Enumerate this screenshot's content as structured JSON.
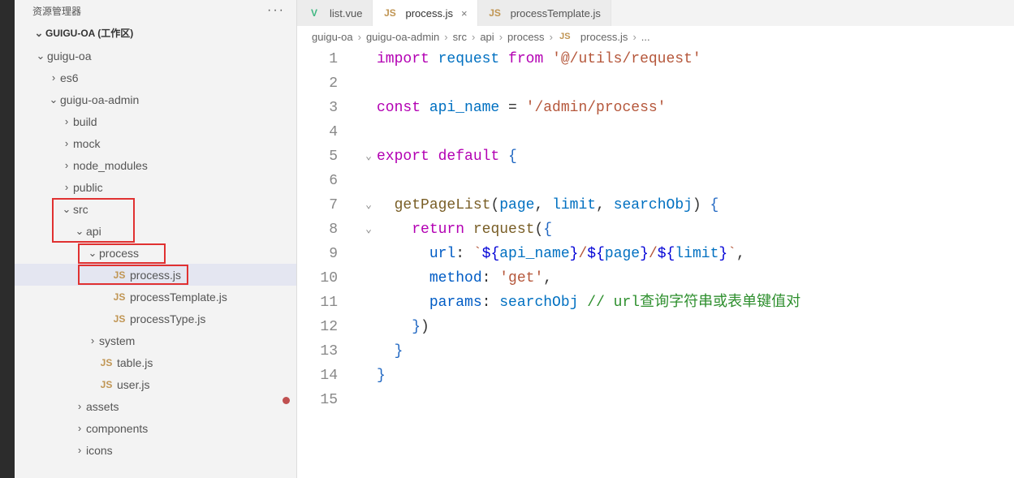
{
  "sidebar": {
    "header": "资源管理器",
    "workspace": "GUIGU-OA (工作区)",
    "tree": [
      {
        "indent": 1,
        "chevron": "down",
        "label": "guigu-oa"
      },
      {
        "indent": 2,
        "chevron": "right",
        "label": "es6"
      },
      {
        "indent": 2,
        "chevron": "down",
        "label": "guigu-oa-admin"
      },
      {
        "indent": 3,
        "chevron": "right",
        "label": "build"
      },
      {
        "indent": 3,
        "chevron": "right",
        "label": "mock"
      },
      {
        "indent": 3,
        "chevron": "right",
        "label": "node_modules"
      },
      {
        "indent": 3,
        "chevron": "right",
        "label": "public"
      },
      {
        "indent": 3,
        "chevron": "down",
        "label": "src"
      },
      {
        "indent": 4,
        "chevron": "down",
        "label": "api"
      },
      {
        "indent": 5,
        "chevron": "down",
        "label": "process"
      },
      {
        "indent": 6,
        "chevron": "",
        "icon": "JS",
        "label": "process.js",
        "selected": true
      },
      {
        "indent": 6,
        "chevron": "",
        "icon": "JS",
        "label": "processTemplate.js"
      },
      {
        "indent": 6,
        "chevron": "",
        "icon": "JS",
        "label": "processType.js"
      },
      {
        "indent": 5,
        "chevron": "right",
        "label": "system"
      },
      {
        "indent": 5,
        "chevron": "",
        "icon": "JS",
        "label": "table.js"
      },
      {
        "indent": 5,
        "chevron": "",
        "icon": "JS",
        "label": "user.js"
      },
      {
        "indent": 4,
        "chevron": "right",
        "label": "assets"
      },
      {
        "indent": 4,
        "chevron": "right",
        "label": "components"
      },
      {
        "indent": 4,
        "chevron": "right",
        "label": "icons"
      }
    ]
  },
  "tabs": [
    {
      "icon": "V",
      "iconClass": "vue-icon",
      "label": "list.vue",
      "active": false
    },
    {
      "icon": "JS",
      "iconClass": "js-icon",
      "label": "process.js",
      "active": true,
      "close": true
    },
    {
      "icon": "JS",
      "iconClass": "js-icon",
      "label": "processTemplate.js",
      "active": false
    }
  ],
  "breadcrumb": [
    "guigu-oa",
    "guigu-oa-admin",
    "src",
    "api",
    "process",
    "process.js",
    "..."
  ],
  "breadcrumb_file_icon": "JS",
  "code": {
    "line_count": 15,
    "folds": {
      "5": "v",
      "7": "v",
      "8": "v"
    },
    "dirty_line": 15,
    "lines": {
      "1": [
        [
          "kw",
          "import "
        ],
        [
          "var",
          "request"
        ],
        [
          "kw",
          " from "
        ],
        [
          "str",
          "'@/utils/request'"
        ]
      ],
      "2": [],
      "3": [
        [
          "kw",
          "const "
        ],
        [
          "var",
          "api_name"
        ],
        [
          "",
          " = "
        ],
        [
          "str",
          "'/admin/process'"
        ]
      ],
      "4": [],
      "5": [
        [
          "kw",
          "export default "
        ],
        [
          "brace",
          "{"
        ]
      ],
      "6": [],
      "7": [
        [
          "",
          "  "
        ],
        [
          "fn",
          "getPageList"
        ],
        [
          "",
          "("
        ],
        [
          "prop",
          "page"
        ],
        [
          "",
          ", "
        ],
        [
          "prop",
          "limit"
        ],
        [
          "",
          ", "
        ],
        [
          "prop",
          "searchObj"
        ],
        [
          "",
          ") "
        ],
        [
          "brace",
          "{"
        ]
      ],
      "8": [
        [
          "",
          "    "
        ],
        [
          "kw",
          "return "
        ],
        [
          "fn",
          "request"
        ],
        [
          "",
          "("
        ],
        [
          "brace",
          "{"
        ]
      ],
      "9": [
        [
          "",
          "      "
        ],
        [
          "mem",
          "url"
        ],
        [
          "",
          ": "
        ],
        [
          "str",
          "`"
        ],
        [
          "tmpl",
          "${"
        ],
        [
          "var",
          "api_name"
        ],
        [
          "tmpl",
          "}"
        ],
        [
          "str",
          "/"
        ],
        [
          "tmpl",
          "${"
        ],
        [
          "prop",
          "page"
        ],
        [
          "tmpl",
          "}"
        ],
        [
          "str",
          "/"
        ],
        [
          "tmpl",
          "${"
        ],
        [
          "prop",
          "limit"
        ],
        [
          "tmpl",
          "}"
        ],
        [
          "str",
          "`"
        ],
        [
          "",
          ","
        ]
      ],
      "10": [
        [
          "",
          "      "
        ],
        [
          "mem",
          "method"
        ],
        [
          "",
          ": "
        ],
        [
          "str",
          "'get'"
        ],
        [
          "",
          ","
        ]
      ],
      "11": [
        [
          "",
          "      "
        ],
        [
          "mem",
          "params"
        ],
        [
          "",
          ": "
        ],
        [
          "prop",
          "searchObj"
        ],
        [
          "",
          " "
        ],
        [
          "com",
          "// url查询字符串或表单键值对"
        ]
      ],
      "12": [
        [
          "",
          "    "
        ],
        [
          "brace",
          "}"
        ],
        [
          "",
          ")"
        ]
      ],
      "13": [
        [
          "",
          "  "
        ],
        [
          "brace",
          "}"
        ]
      ],
      "14": [
        [
          "brace",
          "}"
        ]
      ],
      "15": []
    }
  }
}
